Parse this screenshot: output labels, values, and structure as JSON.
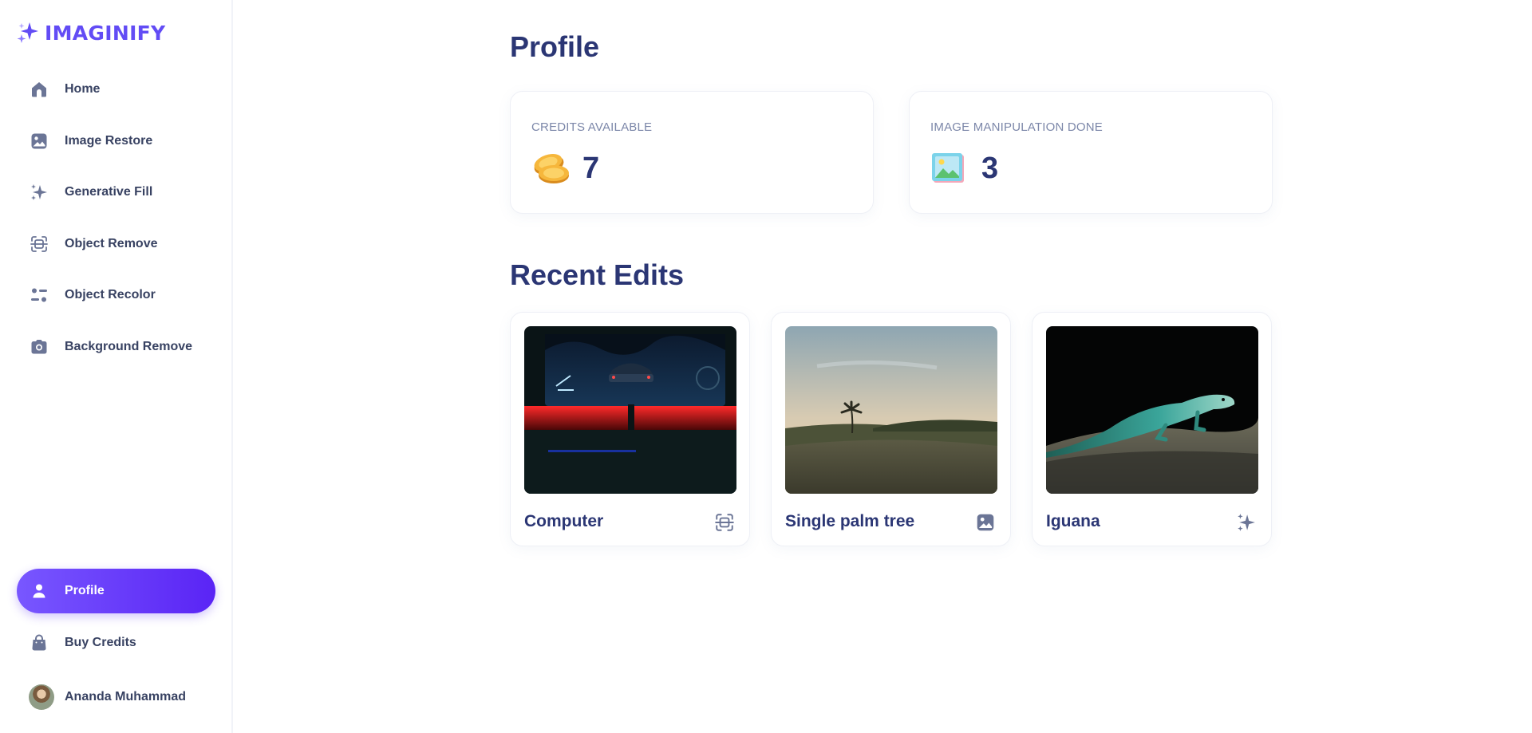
{
  "app": {
    "logo_text": "IMAGINIFY",
    "accent_color": "#624cf5"
  },
  "sidebar": {
    "items": [
      {
        "label": "Home",
        "icon": "home-icon"
      },
      {
        "label": "Image Restore",
        "icon": "image-icon"
      },
      {
        "label": "Generative Fill",
        "icon": "stars-icon"
      },
      {
        "label": "Object Remove",
        "icon": "scan-icon"
      },
      {
        "label": "Object Recolor",
        "icon": "filter-icon"
      },
      {
        "label": "Background Remove",
        "icon": "camera-icon"
      }
    ],
    "bottom_items": [
      {
        "label": "Profile",
        "icon": "user-icon",
        "active": true
      },
      {
        "label": "Buy Credits",
        "icon": "bag-icon",
        "active": false
      }
    ],
    "user": {
      "name": "Ananda Muhammad"
    }
  },
  "main": {
    "title": "Profile",
    "stats": [
      {
        "label": "CREDITS AVAILABLE",
        "value": "7",
        "icon": "coins-icon"
      },
      {
        "label": "IMAGE MANIPULATION DONE",
        "value": "3",
        "icon": "framed-picture-icon"
      }
    ],
    "recent_title": "Recent Edits",
    "recent_edits": [
      {
        "title": "Computer",
        "icon": "scan-icon"
      },
      {
        "title": "Single palm tree",
        "icon": "image-icon"
      },
      {
        "title": "Iguana",
        "icon": "stars-icon"
      }
    ]
  }
}
